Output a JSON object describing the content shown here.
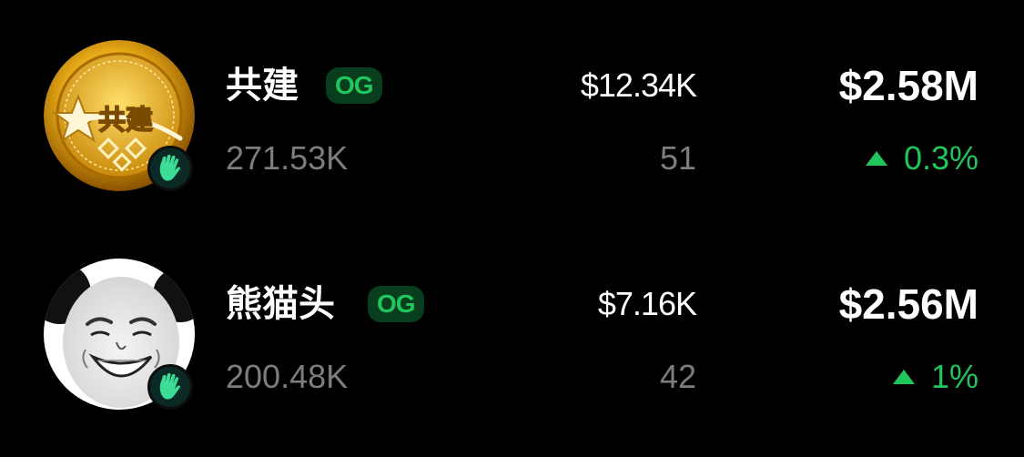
{
  "tokens": [
    {
      "name": "共建",
      "badge": "OG",
      "holders": "271.53K",
      "volume": "$12.34K",
      "txns": "51",
      "market_cap": "$2.58M",
      "change": "0.3%",
      "change_direction": "up",
      "avatar_icon": "gold-coin-icon",
      "badge_icon": "waving-hand-icon",
      "avatar_text": "共建"
    },
    {
      "name": "熊猫头",
      "badge": "OG",
      "holders": "200.48K",
      "volume": "$7.16K",
      "txns": "42",
      "market_cap": "$2.56M",
      "change": "1%",
      "change_direction": "up",
      "avatar_icon": "panda-meme-face-icon",
      "badge_icon": "waving-hand-icon"
    }
  ],
  "colors": {
    "background": "#000000",
    "primary_text": "#ffffff",
    "secondary_text": "#7d7d7d",
    "positive": "#20c65c",
    "og_badge_bg": "#083d1e",
    "hand_badge_bg": "#0b2a26",
    "hand_icon": "#3ddc97"
  }
}
